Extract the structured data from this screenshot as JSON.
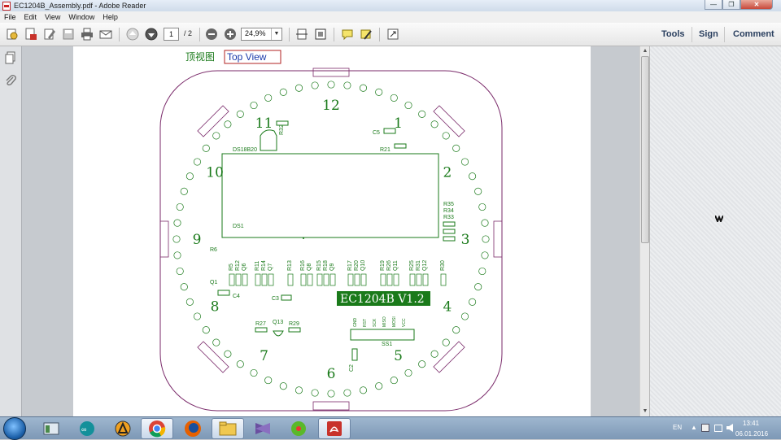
{
  "window": {
    "title": "EC1204B_Assembly.pdf - Adobe Reader"
  },
  "menu": [
    "File",
    "Edit",
    "View",
    "Window",
    "Help"
  ],
  "toolbar": {
    "page_current": "1",
    "page_total": "/ 2",
    "zoom": "24,9%",
    "tools_label": "Tools",
    "sign_label": "Sign",
    "comment_label": "Comment"
  },
  "pcb": {
    "cn_title": "顶视图",
    "title": "Top View",
    "board_label": "EC1204B  V1.2",
    "hours": [
      "12",
      "1",
      "2",
      "3",
      "4",
      "5",
      "6",
      "7",
      "8",
      "9",
      "10",
      "11"
    ],
    "parts": {
      "ds18b20": "DS18B20",
      "ds1": "DS1",
      "r32": "R32",
      "c5": "C5",
      "r21": "R21",
      "r35": "R35",
      "r34": "R34",
      "r33": "R33",
      "r6": "R6",
      "r5": "R5",
      "r12": "R12",
      "q6": "Q6",
      "r11": "R11",
      "r14": "R14",
      "q7": "Q7",
      "r13": "R13",
      "r16": "R16",
      "q8": "Q8",
      "r15": "R15",
      "r18": "R18",
      "q9": "Q9",
      "r17": "R17",
      "r20": "R20",
      "q10": "Q10",
      "r19": "R19",
      "r26": "R26",
      "q11": "Q11",
      "r25": "R25",
      "r31": "R31",
      "q12": "Q12",
      "r30": "R30",
      "q1": "Q1",
      "c4": "C4",
      "c3": "C3",
      "r27": "R27",
      "q13": "Q13",
      "r29": "R29",
      "ss1": "SS1",
      "c2": "C2",
      "gnd": "GND",
      "rst": "RST",
      "sck": "SCK",
      "miso": "MISO",
      "mosi": "MOSI",
      "vcc": "VCC"
    }
  },
  "taskbar": {
    "lang": "EN",
    "time": "13:41",
    "date": "06.01.2016"
  },
  "colors": {
    "silk": "#1a7a1a",
    "outline": "#7a2a6a",
    "title_border": "#b22222",
    "title_text": "#1a3aaa"
  }
}
